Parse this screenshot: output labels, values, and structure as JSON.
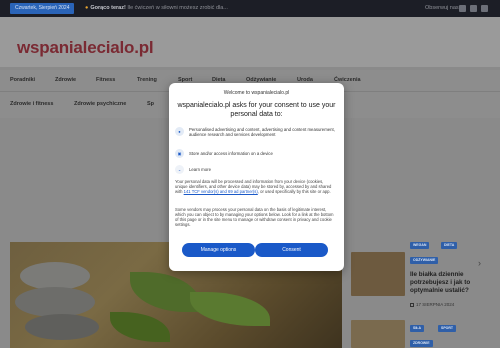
{
  "topbar": {
    "date": "Czwartek, Sierpień 2024",
    "ticker_icon": "dot-icon",
    "ticker_bold": "Gorąco teraz!",
    "ticker_text": "Ile ćwiczeń w siłowni możesz zrobić dla...",
    "follow_label": "Obserwuj nas"
  },
  "site": {
    "logo": "wspanialecialo.pl"
  },
  "nav": {
    "items": [
      "Poradniki",
      "Zdrowie",
      "Fitness",
      "Trening",
      "Sport",
      "Dieta",
      "Odżywianie",
      "Uroda",
      "Ćwiczenia"
    ]
  },
  "nav2": {
    "items": [
      "Zdrowie i fitness",
      "Zdrowie psychiczne",
      "Sp"
    ]
  },
  "sidebar_article": {
    "tags": [
      "WEGAN",
      "DIETA",
      "ODŻYWIANIE"
    ],
    "title": "Ile białka dziennie potrzebujesz i jak to optymalnie ustalić?",
    "date": "17 SIERPNIA 2024",
    "tags2": [
      "SIŁA",
      "SPORT",
      "ZDROWIE"
    ]
  },
  "consent": {
    "site_name": "Welcome to wspanialecialo.pl",
    "heading": "wspanialecialo.pl asks for your consent to use your personal data to:",
    "purposes": [
      {
        "icon": "person-icon",
        "text": "Personalised advertising and content, advertising and content measurement, audience research and services development"
      },
      {
        "icon": "device-icon",
        "text": "Store and/or access information on a device"
      }
    ],
    "learn_more": "Learn more",
    "para1_pre": "Your personal data will be processed and information from your device (cookies, unique identifiers, and other device data) may be stored by, accessed by and shared with ",
    "para1_link": "141 TCF vendor(s) and 69 ad partner(s)",
    "para1_post": ", or used specifically by this site or app.",
    "para2": "Some vendors may process your personal data on the basis of legitimate interest, which you can object to by managing your options below. Look for a link at the bottom of this page or in the site menu to manage or withdraw consent in privacy and cookie settings.",
    "manage_label": "Manage options",
    "consent_label": "Consent"
  }
}
